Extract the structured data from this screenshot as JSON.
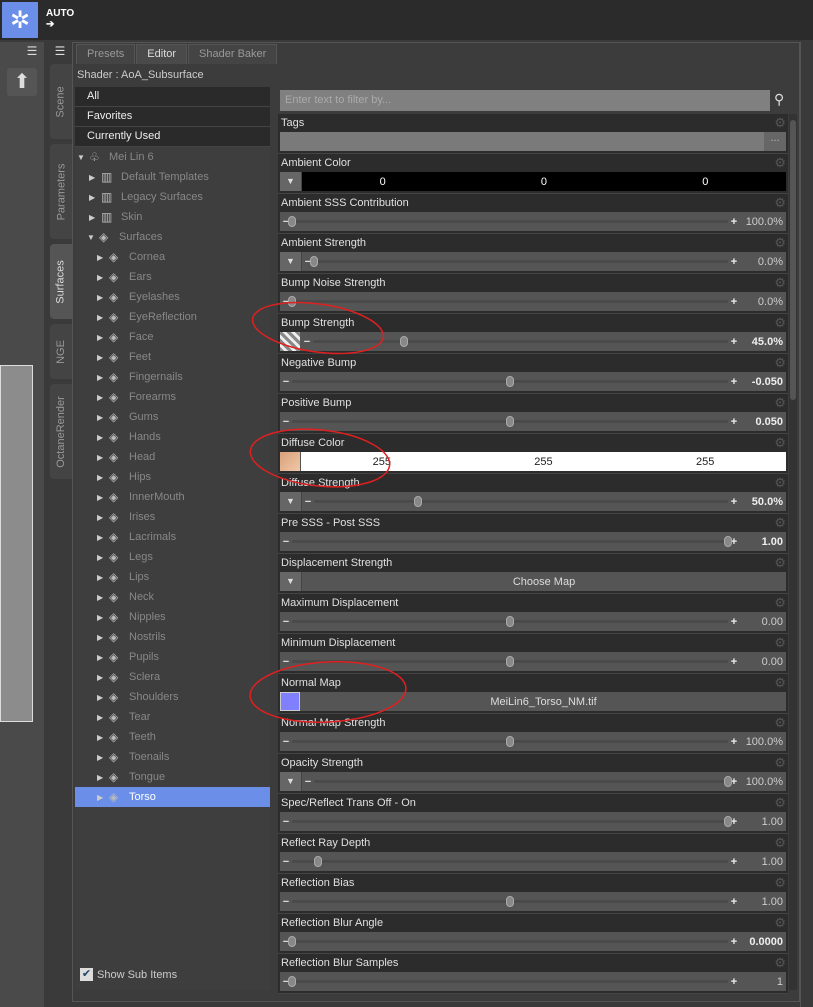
{
  "toolbar": {
    "auto_label": "AUTO"
  },
  "tabs": [
    "Presets",
    "Editor",
    "Shader Baker"
  ],
  "side_tabs": [
    "Scene",
    "Parameters",
    "Surfaces",
    "NGE",
    "OctaneRender"
  ],
  "shader_label": "Shader : AoA_Subsurface",
  "filters": [
    "All",
    "Favorites",
    "Currently Used"
  ],
  "tree": {
    "root": "Mei Lin 6",
    "groups": [
      "Default Templates",
      "Legacy Surfaces",
      "Skin"
    ],
    "surfaces_label": "Surfaces",
    "surfaces": [
      "Cornea",
      "Ears",
      "Eyelashes",
      "EyeReflection",
      "Face",
      "Feet",
      "Fingernails",
      "Forearms",
      "Gums",
      "Hands",
      "Head",
      "Hips",
      "InnerMouth",
      "Irises",
      "Lacrimals",
      "Legs",
      "Lips",
      "Neck",
      "Nipples",
      "Nostrils",
      "Pupils",
      "Sclera",
      "Shoulders",
      "Tear",
      "Teeth",
      "Toenails",
      "Tongue",
      "Torso"
    ],
    "selected": "Torso"
  },
  "show_sub_items": "Show Sub Items",
  "filter_placeholder": "Enter text to filter by...",
  "tags": {
    "label": "Tags",
    "button": "..."
  },
  "properties": [
    {
      "label": "Ambient Color",
      "type": "color",
      "pre": "dd",
      "color": "#000000",
      "rgb": [
        "0",
        "0",
        "0"
      ]
    },
    {
      "label": "Ambient SSS Contribution",
      "type": "slider",
      "pre": "",
      "value": "100.0%",
      "pos": 0.0
    },
    {
      "label": "Ambient Strength",
      "type": "slider",
      "pre": "dd",
      "value": "0.0%",
      "pos": 0.0
    },
    {
      "label": "Bump Noise Strength",
      "type": "slider",
      "pre": "",
      "value": "0.0%",
      "pos": 0.0
    },
    {
      "label": "Bump Strength",
      "type": "slider",
      "pre": "map",
      "value": "45.0%",
      "pos": 0.22,
      "bold": true
    },
    {
      "label": "Negative Bump",
      "type": "slider",
      "pre": "",
      "value": "-0.050",
      "pos": 0.5,
      "bold": true
    },
    {
      "label": "Positive Bump",
      "type": "slider",
      "pre": "",
      "value": "0.050",
      "pos": 0.5,
      "bold": true
    },
    {
      "label": "Diffuse Color",
      "type": "color",
      "pre": "map",
      "color": "#ffffff",
      "rgb": [
        "255",
        "255",
        "255"
      ]
    },
    {
      "label": "Diffuse Strength",
      "type": "slider",
      "pre": "dd",
      "value": "50.0%",
      "pos": 0.25,
      "bold": true
    },
    {
      "label": "Pre SSS - Post SSS",
      "type": "slider",
      "pre": "",
      "value": "1.00",
      "pos": 1.0,
      "bold": true
    },
    {
      "label": "Displacement Strength",
      "type": "button",
      "pre": "dd",
      "value": "Choose Map"
    },
    {
      "label": "Maximum Displacement",
      "type": "slider",
      "pre": "",
      "value": "0.00",
      "pos": 0.5
    },
    {
      "label": "Minimum Displacement",
      "type": "slider",
      "pre": "",
      "value": "0.00",
      "pos": 0.5
    },
    {
      "label": "Normal Map",
      "type": "button",
      "pre": "swatch",
      "swatch": "#8080ff",
      "value": "MeiLin6_Torso_NM.tif"
    },
    {
      "label": "Normal Map Strength",
      "type": "slider",
      "pre": "",
      "value": "100.0%",
      "pos": 0.5
    },
    {
      "label": "Opacity Strength",
      "type": "slider",
      "pre": "dd",
      "value": "100.0%",
      "pos": 1.0
    },
    {
      "label": "Spec/Reflect Trans Off - On",
      "type": "slider",
      "pre": "",
      "value": "1.00",
      "pos": 1.0
    },
    {
      "label": "Reflect Ray Depth",
      "type": "slider",
      "pre": "",
      "value": "1.00",
      "pos": 0.06
    },
    {
      "label": "Reflection Bias",
      "type": "slider",
      "pre": "",
      "value": "1.00",
      "pos": 0.5
    },
    {
      "label": "Reflection Blur Angle",
      "type": "slider",
      "pre": "",
      "value": "0.0000",
      "pos": 0.0,
      "bold": true
    },
    {
      "label": "Reflection Blur Samples",
      "type": "slider",
      "pre": "",
      "value": "1",
      "pos": 0.0
    }
  ],
  "colors": {
    "accent": "#6b8fe8",
    "annotation": "#e02020"
  }
}
